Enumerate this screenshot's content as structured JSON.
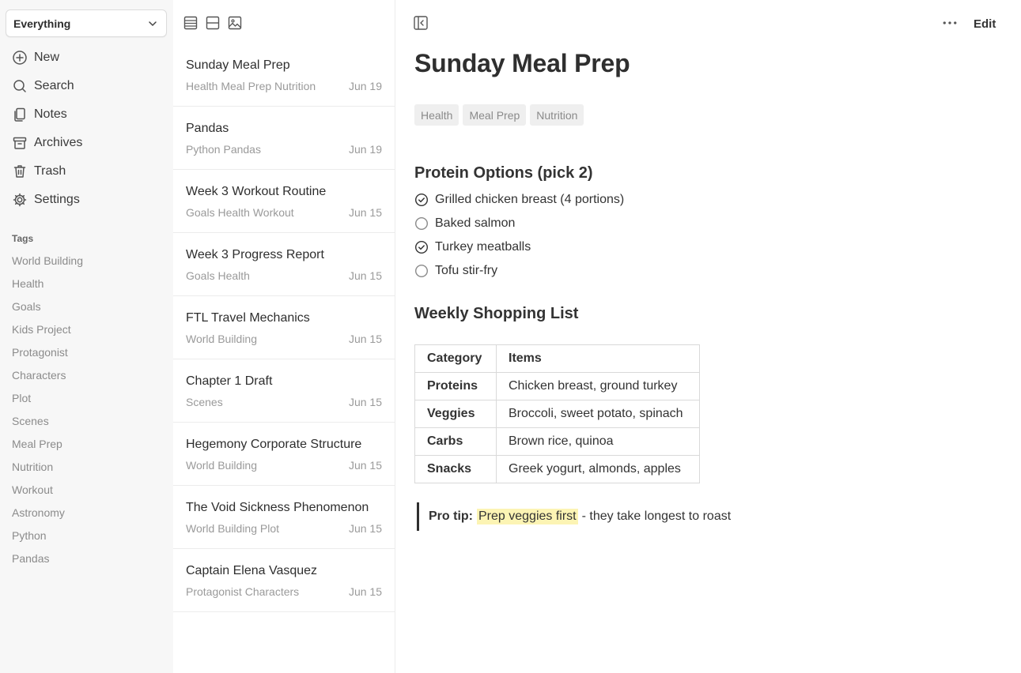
{
  "sidebar": {
    "scope": "Everything",
    "nav": [
      {
        "label": "New",
        "icon": "plus-circle-icon"
      },
      {
        "label": "Search",
        "icon": "search-icon"
      },
      {
        "label": "Notes",
        "icon": "notes-icon"
      },
      {
        "label": "Archives",
        "icon": "archive-icon"
      },
      {
        "label": "Trash",
        "icon": "trash-icon"
      },
      {
        "label": "Settings",
        "icon": "gear-icon"
      }
    ],
    "tags_heading": "Tags",
    "tags": [
      "World Building",
      "Health",
      "Goals",
      "Kids Project",
      "Protagonist",
      "Characters",
      "Plot",
      "Scenes",
      "Meal Prep",
      "Nutrition",
      "Workout",
      "Astronomy",
      "Python",
      "Pandas"
    ]
  },
  "notes": [
    {
      "title": "Sunday Meal Prep",
      "tags": "Health Meal Prep Nutrition",
      "date": "Jun 19"
    },
    {
      "title": "Pandas",
      "tags": "Python Pandas",
      "date": "Jun 19"
    },
    {
      "title": "Week 3 Workout Routine",
      "tags": "Goals Health Workout",
      "date": "Jun 15"
    },
    {
      "title": "Week 3 Progress Report",
      "tags": "Goals Health",
      "date": "Jun 15"
    },
    {
      "title": "FTL Travel Mechanics",
      "tags": "World Building",
      "date": "Jun 15"
    },
    {
      "title": "Chapter 1 Draft",
      "tags": "Scenes",
      "date": "Jun 15"
    },
    {
      "title": "Hegemony Corporate Structure",
      "tags": "World Building",
      "date": "Jun 15"
    },
    {
      "title": "The Void Sickness Phenomenon",
      "tags": "World Building Plot",
      "date": "Jun 15"
    },
    {
      "title": "Captain Elena Vasquez",
      "tags": "Protagonist Characters",
      "date": "Jun 15"
    }
  ],
  "editor": {
    "edit_label": "Edit",
    "title": "Sunday Meal Prep",
    "tags": [
      "Health",
      "Meal Prep",
      "Nutrition"
    ],
    "protein_heading": "Protein Options (pick 2)",
    "checklist": [
      {
        "text": "Grilled chicken breast (4 portions)",
        "checked": true
      },
      {
        "text": "Baked salmon",
        "checked": false
      },
      {
        "text": "Turkey meatballs",
        "checked": true
      },
      {
        "text": "Tofu stir-fry",
        "checked": false
      }
    ],
    "shopping_heading": "Weekly Shopping List",
    "table": {
      "headers": [
        "Category",
        "Items"
      ],
      "rows": [
        [
          "Proteins",
          "Chicken breast, ground turkey"
        ],
        [
          "Veggies",
          "Broccoli, sweet potato, spinach"
        ],
        [
          "Carbs",
          "Brown rice, quinoa"
        ],
        [
          "Snacks",
          "Greek yogurt, almonds, apples"
        ]
      ]
    },
    "tip": {
      "label": "Pro tip:",
      "highlight": "Prep veggies first",
      "rest": "- they take longest to roast"
    }
  }
}
